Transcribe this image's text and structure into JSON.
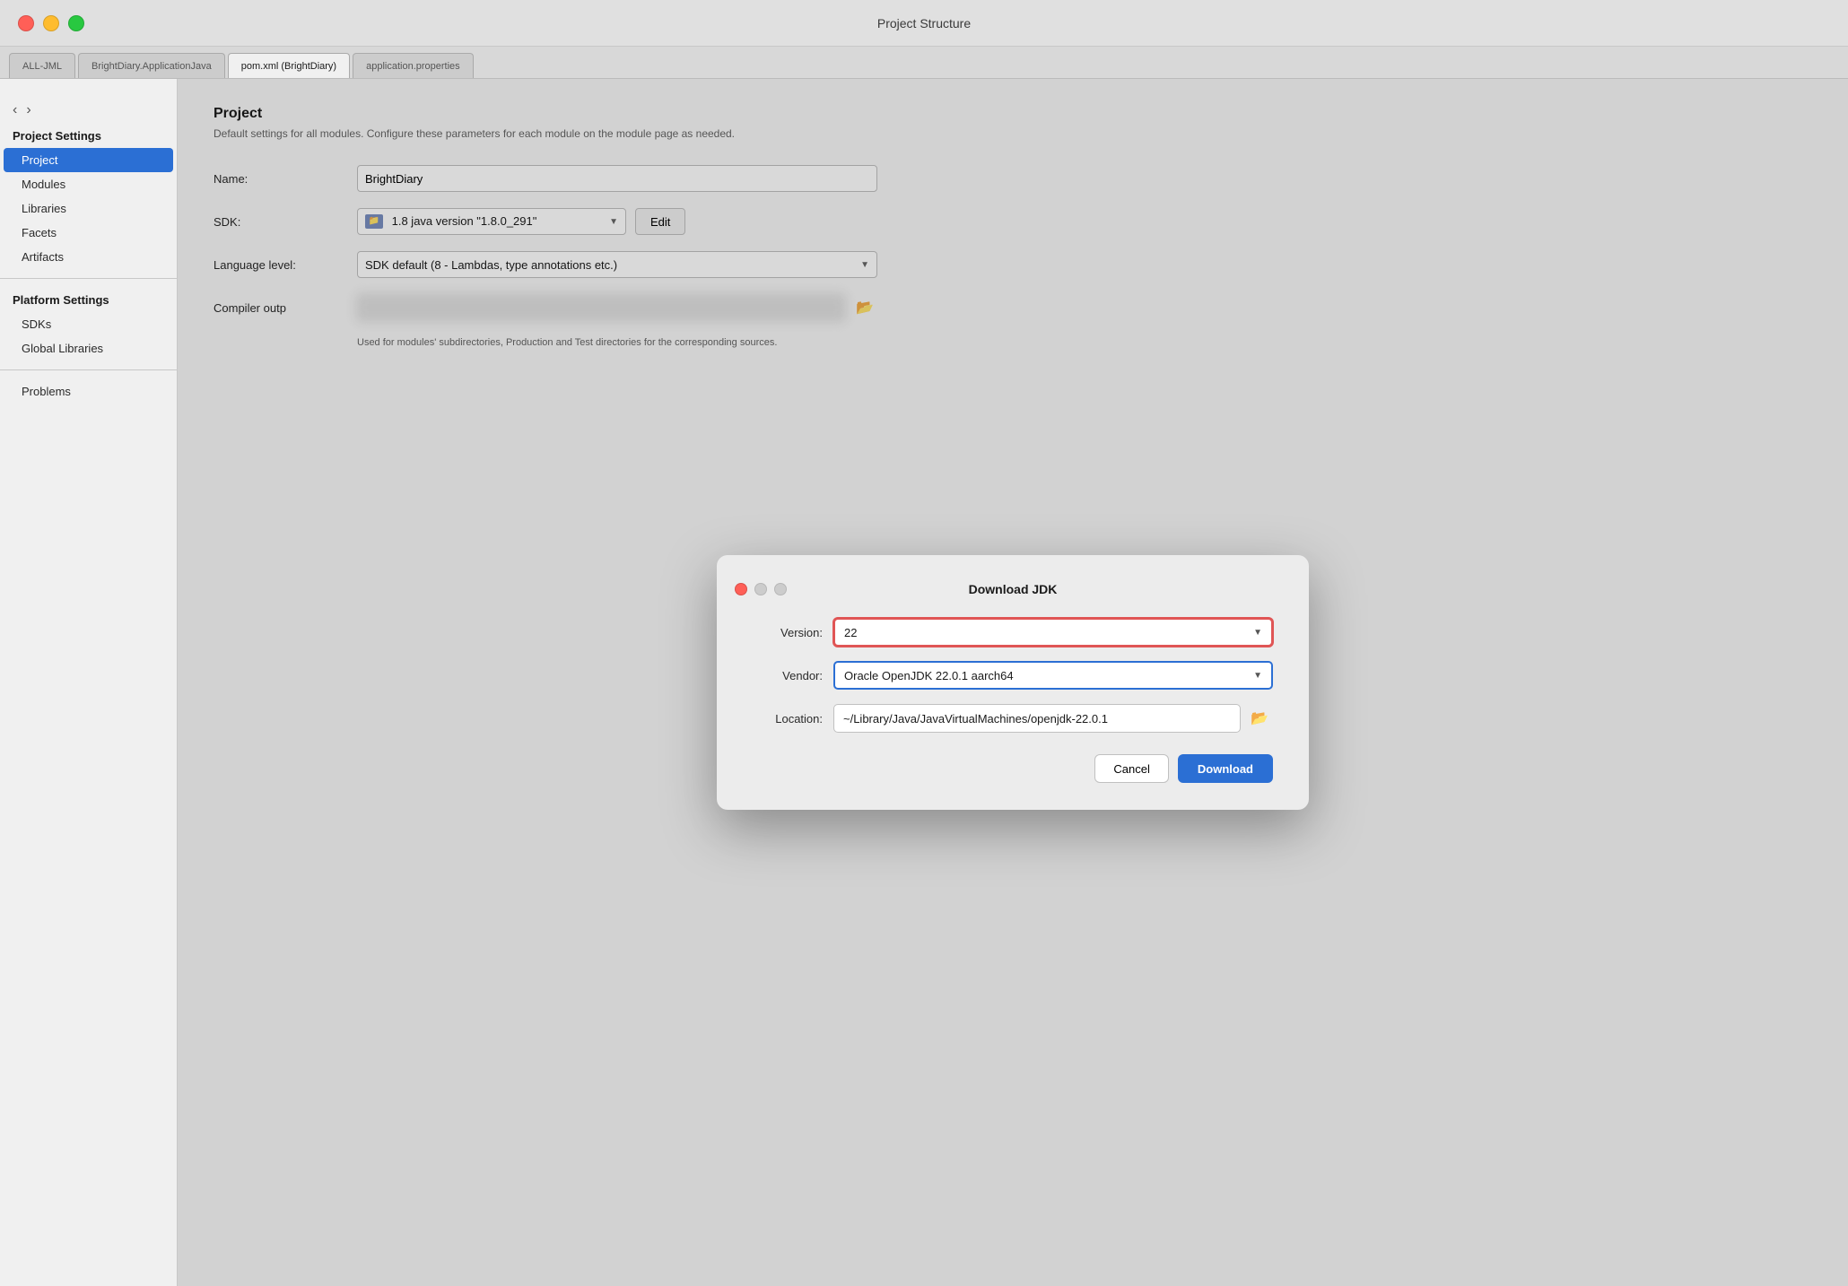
{
  "titleBar": {
    "title": "Project Structure",
    "controls": [
      "close",
      "minimize",
      "maximize"
    ]
  },
  "tabs": [
    {
      "id": "tab-all",
      "label": "ALL-JML"
    },
    {
      "id": "tab-brightdiary",
      "label": "BrightDiary.ApplicationJava"
    },
    {
      "id": "tab-pom",
      "label": "pom.xml (BrightDiary)"
    },
    {
      "id": "tab-properties",
      "label": "application.properties"
    }
  ],
  "sidebar": {
    "projectSettings": {
      "title": "Project Settings",
      "items": [
        {
          "id": "project",
          "label": "Project",
          "active": true
        },
        {
          "id": "modules",
          "label": "Modules"
        },
        {
          "id": "libraries",
          "label": "Libraries"
        },
        {
          "id": "facets",
          "label": "Facets"
        },
        {
          "id": "artifacts",
          "label": "Artifacts"
        }
      ]
    },
    "platformSettings": {
      "title": "Platform Settings",
      "items": [
        {
          "id": "sdks",
          "label": "SDKs"
        },
        {
          "id": "global-libraries",
          "label": "Global Libraries"
        }
      ]
    },
    "other": [
      {
        "id": "problems",
        "label": "Problems"
      }
    ]
  },
  "content": {
    "title": "Project",
    "subtitle": "Default settings for all modules. Configure these parameters for each module on the module page as needed.",
    "fields": {
      "name": {
        "label": "Name:",
        "value": "BrightDiary"
      },
      "sdk": {
        "label": "SDK:",
        "value": "1.8  java version \"1.8.0_291\"",
        "editButton": "Edit"
      },
      "languageLevel": {
        "label": "Language level:",
        "value": "SDK default (8 - Lambdas, type annotations etc.)"
      },
      "compilerOutput": {
        "label": "Compiler outp",
        "note": "Used for modules' subdirectories, Production and Test directories for the corresponding sources."
      }
    }
  },
  "modal": {
    "title": "Download JDK",
    "fields": {
      "version": {
        "label": "Version:",
        "value": "22"
      },
      "vendor": {
        "label": "Vendor:",
        "value": "Oracle OpenJDK  22.0.1  aarch64"
      },
      "location": {
        "label": "Location:",
        "value": "~/Library/Java/JavaVirtualMachines/openjdk-22.0.1"
      }
    },
    "buttons": {
      "cancel": "Cancel",
      "download": "Download"
    }
  }
}
